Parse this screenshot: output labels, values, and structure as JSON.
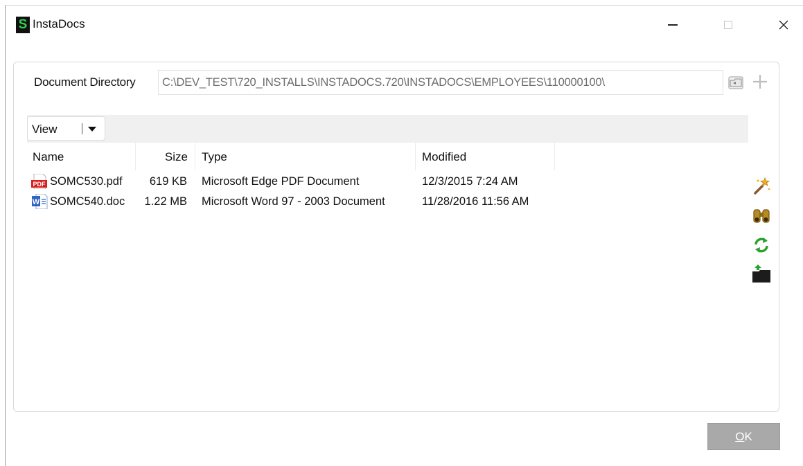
{
  "window": {
    "app_icon_letter": "S",
    "title": "InstaDocs"
  },
  "directory": {
    "label": "Document Directory",
    "path": "C:\\DEV_TEST\\720_INSTALLS\\INSTADOCS.720\\INSTADOCS\\EMPLOYEES\\110000100\\"
  },
  "toolbar": {
    "view_label": "View"
  },
  "columns": {
    "name": "Name",
    "size": "Size",
    "type": "Type",
    "modified": "Modified"
  },
  "files": [
    {
      "icon": "pdf-icon",
      "name": "SOMC530.pdf",
      "size": "619 KB",
      "type": "Microsoft Edge PDF Document",
      "modified": "12/3/2015 7:24 AM"
    },
    {
      "icon": "word-doc-icon",
      "name": "SOMC540.doc",
      "size": "1.22 MB",
      "type": "Microsoft Word 97 - 2003 Document",
      "modified": "11/28/2016 11:56 AM"
    }
  ],
  "side_actions": [
    "magic-wand-icon",
    "binoculars-icon",
    "refresh-icon",
    "upload-folder-icon"
  ],
  "ok_button": {
    "label_underlined": "O",
    "label_rest": "K"
  },
  "colors": {
    "logo_green": "#2fd24a",
    "ok_button_bg": "#a9a9a9",
    "toolbar_bg": "#f0f0f0"
  }
}
